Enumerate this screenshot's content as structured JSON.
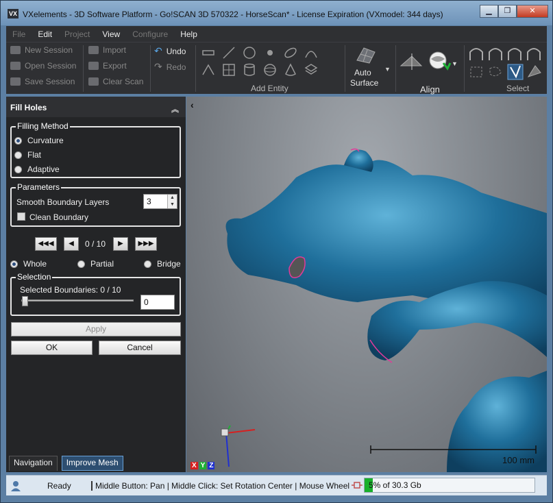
{
  "window": {
    "title": "VXelements - 3D Software Platform - Go!SCAN 3D 570322 - HorseScan* - License Expiration (VXmodel: 344 days)",
    "logo": "VX",
    "controls": [
      "▁",
      "❐",
      "✕"
    ]
  },
  "menu": [
    {
      "label": "File",
      "enabled": false
    },
    {
      "label": "Edit",
      "enabled": true
    },
    {
      "label": "Project",
      "enabled": false
    },
    {
      "label": "View",
      "enabled": true
    },
    {
      "label": "Configure",
      "enabled": false
    },
    {
      "label": "Help",
      "enabled": true
    }
  ],
  "toolbar": {
    "session": [
      "New Session",
      "Open Session",
      "Save Session"
    ],
    "io": [
      "Import",
      "Export",
      "Clear Scan"
    ],
    "undo": "Undo",
    "redo": "Redo",
    "add_entity_label": "Add Entity",
    "auto_surface": [
      "Auto",
      "Surface"
    ],
    "align_label": "Align",
    "select_label": "Select"
  },
  "panel": {
    "title": "Fill Holes",
    "filling_method": {
      "title": "Filling Method",
      "options": [
        "Curvature",
        "Flat",
        "Adaptive"
      ],
      "selected": "Curvature"
    },
    "parameters": {
      "title": "Parameters",
      "smooth_label": "Smooth Boundary Layers",
      "smooth_value": "3",
      "clean_label": "Clean Boundary"
    },
    "navigator": {
      "counter": "0 / 10",
      "first": "◀◀◀",
      "prev": "◀",
      "next": "▶",
      "last": "▶▶▶"
    },
    "scope": {
      "options": [
        "Whole",
        "Partial",
        "Bridge"
      ],
      "selected": "Whole"
    },
    "selection": {
      "title": "Selection",
      "label": "Selected Boundaries: 0 / 10",
      "value": "0"
    },
    "apply": "Apply",
    "ok": "OK",
    "cancel": "Cancel",
    "tabs": [
      "Navigation",
      "Improve Mesh"
    ]
  },
  "viewport": {
    "scale_label": "100 mm",
    "collapse_arrow": "‹",
    "axes": [
      "X",
      "Y",
      "Z"
    ]
  },
  "status": {
    "ready": "Ready",
    "hint": "Middle Button: Pan  |  Middle Click: Set Rotation Center  |  Mouse Wheel",
    "memory": "5% of 30.3 Gb",
    "memory_fraction": 0.05
  },
  "colors": {
    "mesh": "#1f6f9b",
    "boundary": "#e23a9a",
    "memory_bar": "#18b02b"
  }
}
